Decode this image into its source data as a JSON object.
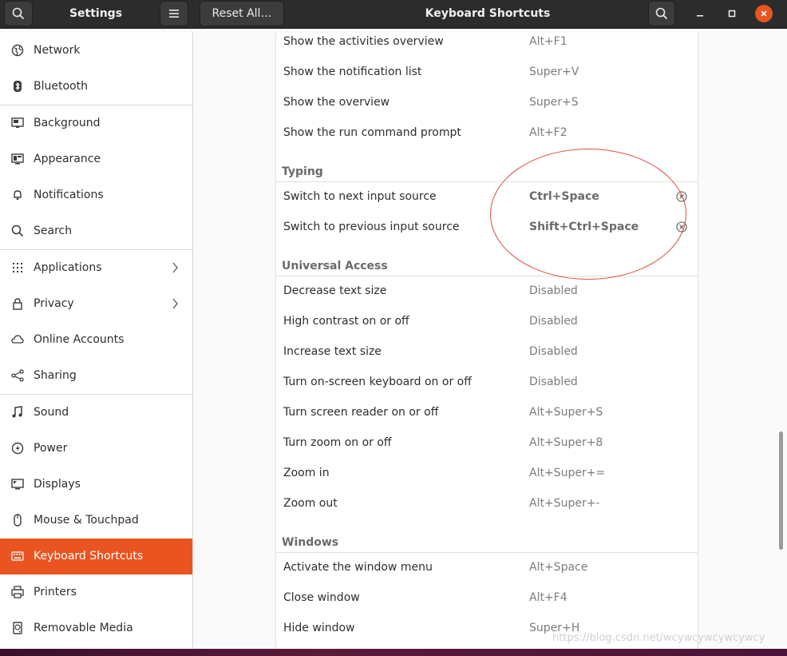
{
  "header": {
    "settings_title": "Settings",
    "reset_label": "Reset All…",
    "page_title": "Keyboard Shortcuts"
  },
  "sidebar": {
    "items": [
      {
        "label": "Network",
        "icon": "globe-icon"
      },
      {
        "label": "Bluetooth",
        "icon": "bluetooth-icon"
      },
      {
        "label": "Background",
        "icon": "monitor-icon"
      },
      {
        "label": "Appearance",
        "icon": "appearance-icon"
      },
      {
        "label": "Notifications",
        "icon": "bell-icon"
      },
      {
        "label": "Search",
        "icon": "search-icon"
      },
      {
        "label": "Applications",
        "icon": "grid-icon"
      },
      {
        "label": "Privacy",
        "icon": "lock-icon"
      },
      {
        "label": "Online Accounts",
        "icon": "cloud-icon"
      },
      {
        "label": "Sharing",
        "icon": "share-icon"
      },
      {
        "label": "Sound",
        "icon": "music-note-icon"
      },
      {
        "label": "Power",
        "icon": "power-icon"
      },
      {
        "label": "Displays",
        "icon": "display-icon"
      },
      {
        "label": "Mouse & Touchpad",
        "icon": "mouse-icon"
      },
      {
        "label": "Keyboard Shortcuts",
        "icon": "keyboard-icon"
      },
      {
        "label": "Printers",
        "icon": "printer-icon"
      },
      {
        "label": "Removable Media",
        "icon": "drive-icon"
      }
    ],
    "active": "Keyboard Shortcuts"
  },
  "shortcuts": {
    "top_rows": [
      {
        "name": "Show the activities overview",
        "accel": "Alt+F1"
      },
      {
        "name": "Show the notification list",
        "accel": "Super+V"
      },
      {
        "name": "Show the overview",
        "accel": "Super+S"
      },
      {
        "name": "Show the run command prompt",
        "accel": "Alt+F2"
      }
    ],
    "typing": {
      "title": "Typing",
      "rows": [
        {
          "name": "Switch to next input source",
          "accel": "Ctrl+Space"
        },
        {
          "name": "Switch to previous input source",
          "accel": "Shift+Ctrl+Space"
        }
      ]
    },
    "universal_access": {
      "title": "Universal Access",
      "rows": [
        {
          "name": "Decrease text size",
          "accel": "Disabled"
        },
        {
          "name": "High contrast on or off",
          "accel": "Disabled"
        },
        {
          "name": "Increase text size",
          "accel": "Disabled"
        },
        {
          "name": "Turn on-screen keyboard on or off",
          "accel": "Disabled"
        },
        {
          "name": "Turn screen reader on or off",
          "accel": "Alt+Super+S"
        },
        {
          "name": "Turn zoom on or off",
          "accel": "Alt+Super+8"
        },
        {
          "name": "Zoom in",
          "accel": "Alt+Super+="
        },
        {
          "name": "Zoom out",
          "accel": "Alt+Super+-"
        }
      ]
    },
    "windows": {
      "title": "Windows",
      "rows": [
        {
          "name": "Activate the window menu",
          "accel": "Alt+Space"
        },
        {
          "name": "Close window",
          "accel": "Alt+F4"
        },
        {
          "name": "Hide window",
          "accel": "Super+H"
        }
      ]
    }
  },
  "watermark": "https://blog.csdn.net/wcywcywcywcywcy",
  "colors": {
    "accent": "#e95420",
    "annotation": "#d94a3a",
    "header": "#2c2c2c"
  }
}
